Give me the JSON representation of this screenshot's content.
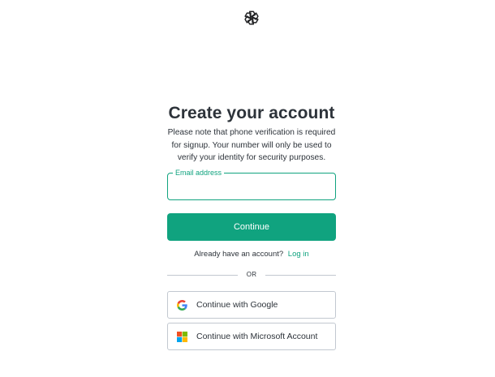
{
  "brand": {
    "logo_icon": "openai-logo-icon",
    "accent_color": "#10a37f",
    "text_color": "#2d333a",
    "border_color": "#c2c8d0"
  },
  "heading": {
    "title": "Create your account",
    "subtitle": "Please note that phone verification is required for signup. Your number will only be used to verify your identity for security purposes."
  },
  "form": {
    "email_label": "Email address",
    "email_value": "",
    "continue_label": "Continue"
  },
  "login": {
    "prompt": "Already have an account?",
    "link_label": "Log in"
  },
  "divider": {
    "label": "OR"
  },
  "social": {
    "google": {
      "label": "Continue with Google",
      "icon": "google-icon"
    },
    "microsoft": {
      "label": "Continue with Microsoft Account",
      "icon": "microsoft-icon"
    }
  }
}
